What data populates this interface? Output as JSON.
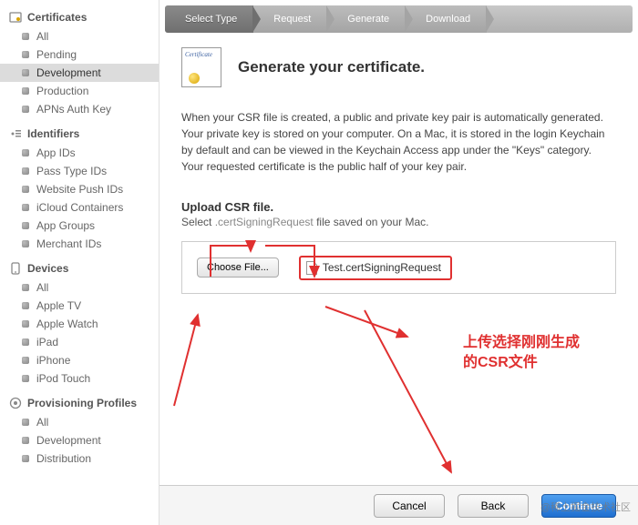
{
  "sidebar": {
    "sections": [
      {
        "title": "Certificates",
        "icon": "certificates",
        "items": [
          "All",
          "Pending",
          "Development",
          "Production",
          "APNs Auth Key"
        ],
        "activeIndex": 2
      },
      {
        "title": "Identifiers",
        "icon": "identifiers",
        "items": [
          "App IDs",
          "Pass Type IDs",
          "Website Push IDs",
          "iCloud Containers",
          "App Groups",
          "Merchant IDs"
        ],
        "activeIndex": -1
      },
      {
        "title": "Devices",
        "icon": "devices",
        "items": [
          "All",
          "Apple TV",
          "Apple Watch",
          "iPad",
          "iPhone",
          "iPod Touch"
        ],
        "activeIndex": -1
      },
      {
        "title": "Provisioning Profiles",
        "icon": "profiles",
        "items": [
          "All",
          "Development",
          "Distribution"
        ],
        "activeIndex": -1
      }
    ]
  },
  "steps": [
    "Select Type",
    "Request",
    "Generate",
    "Download"
  ],
  "activeStep": 0,
  "title": "Generate your certificate.",
  "certIconWord": "Certificate",
  "description": "When your CSR file is created, a public and private key pair is automatically generated. Your private key is stored on your computer. On a Mac, it is stored in the login Keychain by default and can be viewed in the Keychain Access app under the \"Keys\" category. Your requested certificate is the public half of your key pair.",
  "upload": {
    "heading": "Upload CSR file.",
    "prefix": "Select ",
    "ext": ".certSigningRequest",
    "suffix": " file saved on your Mac.",
    "chooseLabel": "Choose File...",
    "fileName": "Test.certSigningRequest"
  },
  "callout_l1": "上传选择刚刚生成",
  "callout_l2": "的CSR文件",
  "buttons": {
    "cancel": "Cancel",
    "back": "Back",
    "continue": "Continue"
  },
  "watermark": "@稀土掘金技术社区"
}
